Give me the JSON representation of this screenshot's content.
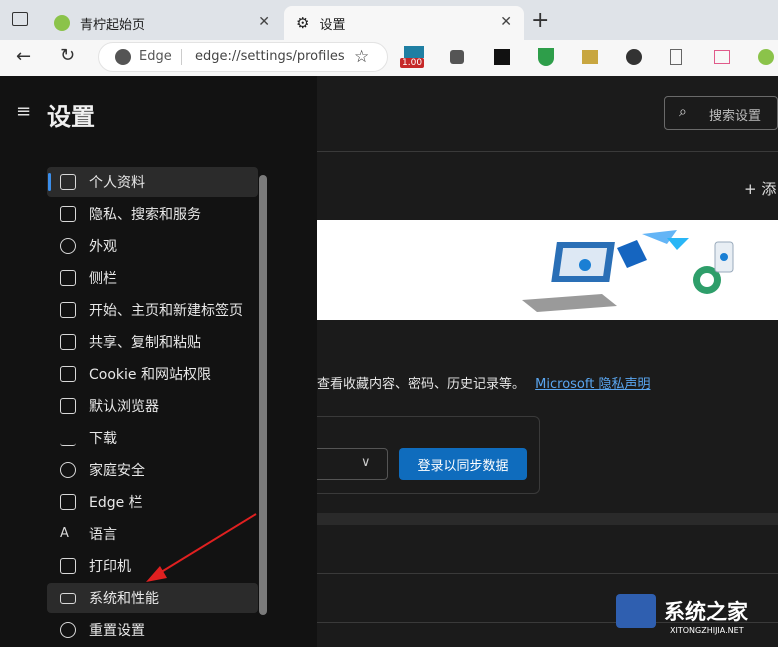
{
  "browser": {
    "tabs": [
      {
        "label": "青柠起始页",
        "icon": "lime-icon"
      },
      {
        "label": "设置",
        "icon": "gear-icon"
      }
    ],
    "address": {
      "site_label": "Edge",
      "url": "edge://settings/profiles"
    },
    "extension_badge": "1.00"
  },
  "settings": {
    "title": "设置",
    "search_placeholder": "搜索设置",
    "nav": [
      {
        "label": "个人资料",
        "icon": "profile-icon"
      },
      {
        "label": "隐私、搜索和服务",
        "icon": "lock-icon"
      },
      {
        "label": "外观",
        "icon": "palette-icon"
      },
      {
        "label": "侧栏",
        "icon": "sidebar-icon"
      },
      {
        "label": "开始、主页和新建标签页",
        "icon": "home-tab-icon"
      },
      {
        "label": "共享、复制和粘贴",
        "icon": "share-icon"
      },
      {
        "label": "Cookie 和网站权限",
        "icon": "cookie-icon"
      },
      {
        "label": "默认浏览器",
        "icon": "browser-icon"
      },
      {
        "label": "下载",
        "icon": "download-icon"
      },
      {
        "label": "家庭安全",
        "icon": "family-icon"
      },
      {
        "label": "Edge 栏",
        "icon": "edge-bar-icon"
      },
      {
        "label": "语言",
        "icon": "language-icon"
      },
      {
        "label": "打印机",
        "icon": "printer-icon"
      },
      {
        "label": "系统和性能",
        "icon": "laptop-icon"
      },
      {
        "label": "重置设置",
        "icon": "reset-icon"
      }
    ],
    "active_index": 0
  },
  "main": {
    "add_profile_glyph": "+ 添",
    "description": "查看收藏内容、密码、历史记录等。",
    "privacy_link": "Microsoft 隐私声明",
    "sync_button": "登录以同步数据"
  },
  "watermark": {
    "text": "系统之家",
    "url": "XITONGZHIJIA.NET"
  },
  "colors": {
    "accent": "#0f6cbd",
    "link": "#5aa6f0",
    "annotation_arrow": "#e02020"
  }
}
